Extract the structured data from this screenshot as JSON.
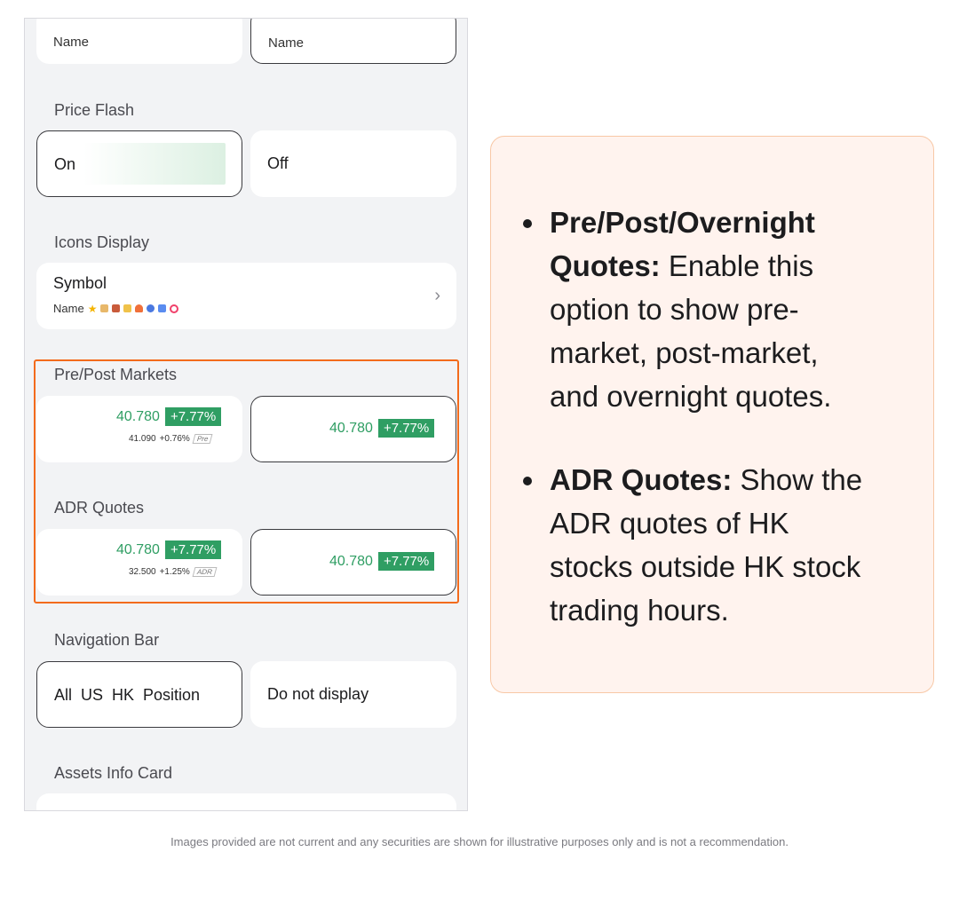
{
  "name_row": {
    "left": "Name",
    "right": "Name"
  },
  "price_flash": {
    "title": "Price Flash",
    "on": "On",
    "off": "Off"
  },
  "icons_display": {
    "title": "Icons Display",
    "symbol": "Symbol",
    "sub": "Name"
  },
  "pre_post": {
    "title": "Pre/Post Markets",
    "left": {
      "price": "40.780",
      "change": "+7.77%",
      "sub_price": "41.090",
      "sub_change": "+0.76%",
      "tag": "Pre"
    },
    "right": {
      "price": "40.780",
      "change": "+7.77%"
    }
  },
  "adr": {
    "title": "ADR Quotes",
    "left": {
      "price": "40.780",
      "change": "+7.77%",
      "sub_price": "32.500",
      "sub_change": "+1.25%",
      "tag": "ADR"
    },
    "right": {
      "price": "40.780",
      "change": "+7.77%"
    }
  },
  "nav_bar": {
    "title": "Navigation Bar",
    "left": "All  US  HK  Position",
    "right": "Do not display"
  },
  "assets_info": {
    "title": "Assets Info Card"
  },
  "callout": {
    "item1_bold": "Pre/Post/Overnight Quotes:",
    "item1_text": " Enable this option to show pre-market, post-market, and overnight quotes.",
    "item2_bold": "ADR Quotes:",
    "item2_text": " Show the ADR quotes of HK stocks outside HK stock trading hours."
  },
  "footer": "Images provided are not current and any securities are shown for illustrative purposes only and is not a recommendation.",
  "colors": {
    "green": "#2f9e63",
    "highlight": "#f36b1c",
    "callout_bg": "#fff3ee"
  }
}
